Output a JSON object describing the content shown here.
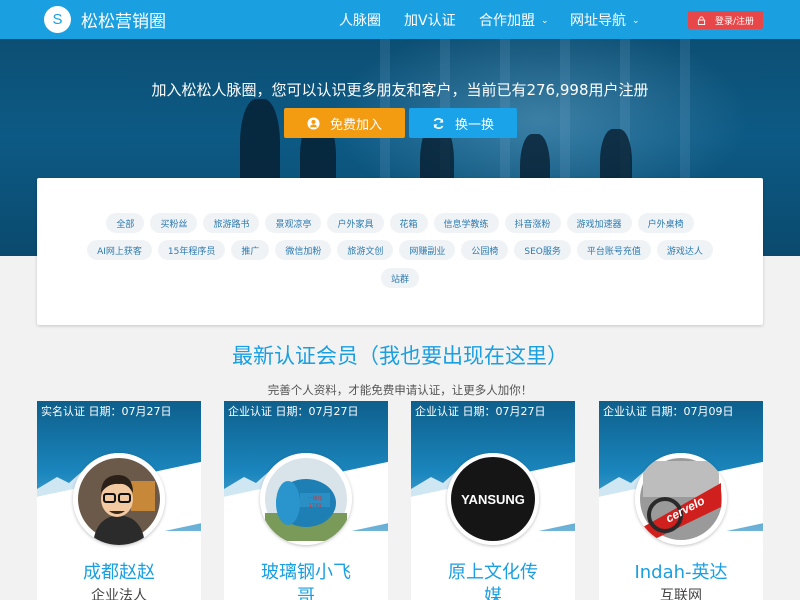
{
  "nav": {
    "logo_letter": "S",
    "logo_text": "松松营销圈",
    "links": [
      "人脉圈",
      "加V认证",
      "合作加盟",
      "网址导航"
    ],
    "login_label": "登录/注册",
    "accent": "#1a9fe0",
    "login_color": "#e8474a"
  },
  "hero": {
    "text": "加入松松人脉圈，您可以认识更多朋友和客户，当前已有276,998用户注册",
    "join_button": "免费加入",
    "swap_button": "换一换",
    "join_color": "#f39c12",
    "swap_color": "#1aa3e8"
  },
  "tags": [
    [
      "全部",
      "买粉丝",
      "旅游路书",
      "景观凉亭",
      "户外家具",
      "花箱",
      "信息学教练",
      "抖音涨粉",
      "游戏加速器",
      "户外桌椅"
    ],
    [
      "AI网上获客",
      "15年程序员",
      "推广",
      "微信加粉",
      "旅游文创",
      "网赚副业",
      "公园椅",
      "SEO服务",
      "平台账号充值",
      "游戏达人"
    ],
    [
      "站群"
    ]
  ],
  "section": {
    "title": "最新认证会员（我也要出现在这里）",
    "subtitle": "完善个人资料，才能免费申请认证，让更多人加你！"
  },
  "members": [
    {
      "badge": "实名认证 日期：07月27日",
      "name": "成都赵赵",
      "type": "企业法人",
      "avatar": "cartoon-man-avatar"
    },
    {
      "badge": "企业认证 日期：07月27日",
      "name": "玻璃钢小飞",
      "name2": "哥",
      "avatar": "tank-photo-avatar"
    },
    {
      "badge": "企业认证 日期：07月27日",
      "name": "原上文化传",
      "name2": "媒",
      "avatar": "yansung-logo-avatar",
      "logo_text": "YANSUNG"
    },
    {
      "badge": "企业认证 日期：07月09日",
      "name": "Indah-英达",
      "type": "互联网",
      "avatar": "cervelo-bike-avatar",
      "logo_text": "cervelo"
    }
  ]
}
